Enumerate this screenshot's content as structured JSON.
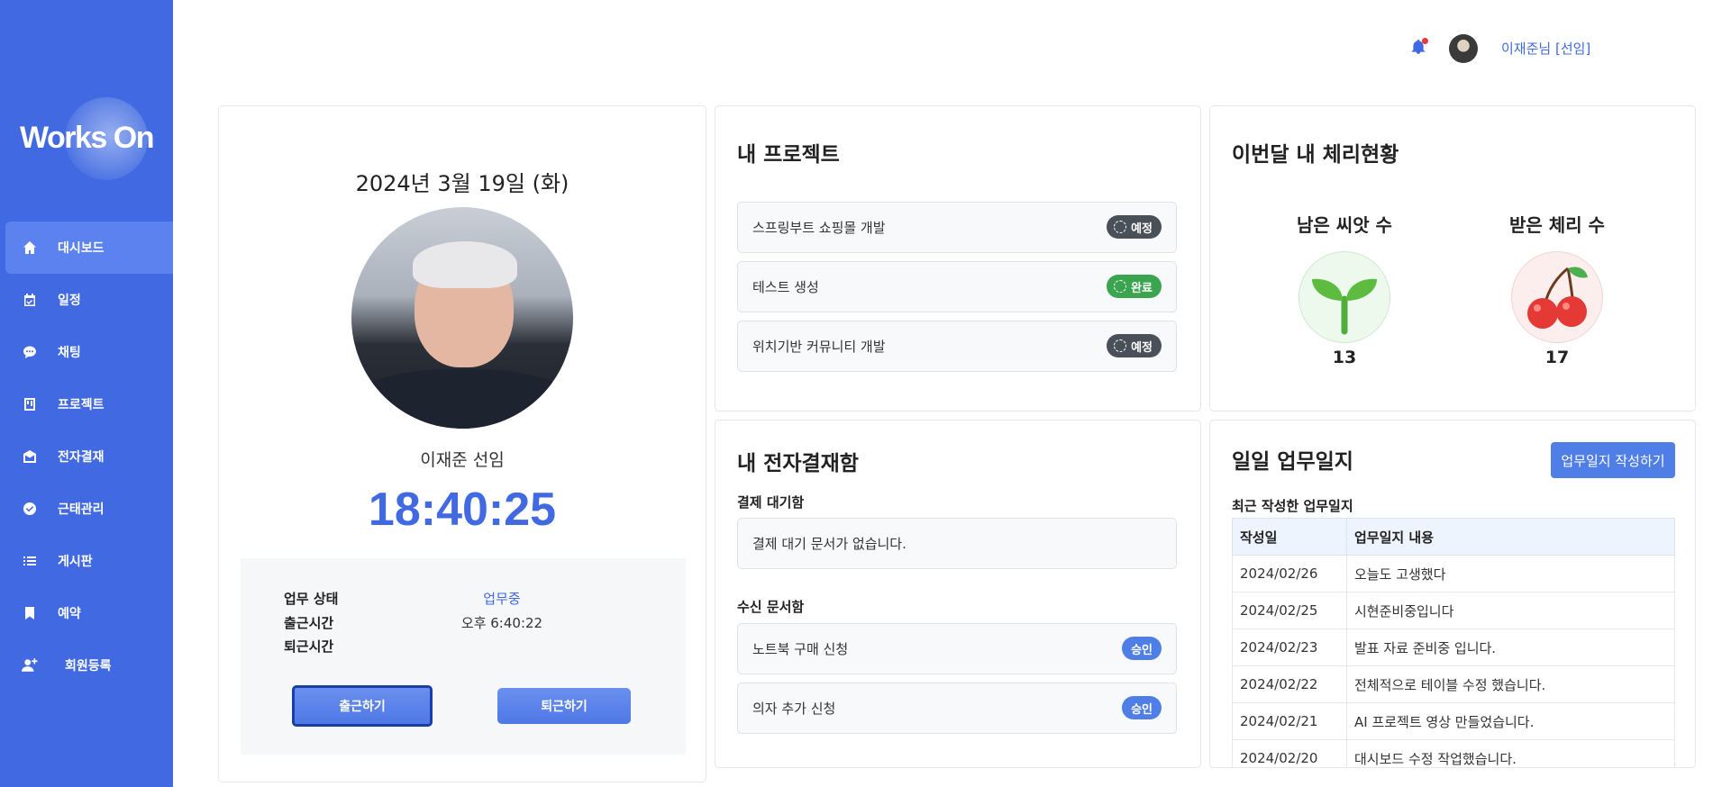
{
  "brand": {
    "logo_text": "Works On"
  },
  "sidebar": {
    "items": [
      {
        "label": "대시보드",
        "icon": "home-icon"
      },
      {
        "label": "일정",
        "icon": "calendar-icon"
      },
      {
        "label": "채팅",
        "icon": "chat-icon"
      },
      {
        "label": "프로젝트",
        "icon": "project-icon"
      },
      {
        "label": "전자결재",
        "icon": "mail-icon"
      },
      {
        "label": "근태관리",
        "icon": "check-badge-icon"
      },
      {
        "label": "게시판",
        "icon": "list-icon"
      },
      {
        "label": "예약",
        "icon": "bookmark-icon"
      },
      {
        "label": "회원등록",
        "icon": "user-add-icon"
      }
    ]
  },
  "header": {
    "user_name": "이재준님 [선임]"
  },
  "profile": {
    "date": "2024년 3월 19일 (화)",
    "name": "이재준 선임",
    "clock": "18:40:25",
    "work_status_label": "업무 상태",
    "work_status_value": "업무중",
    "checkin_label": "출근시간",
    "checkin_value": "오후 6:40:22",
    "checkout_label": "퇴근시간",
    "checkout_value": "",
    "checkin_button": "출근하기",
    "checkout_button": "퇴근하기"
  },
  "projects": {
    "title": "내 프로젝트",
    "items": [
      {
        "name": "스프링부트 쇼핑몰 개발",
        "status": "예정"
      },
      {
        "name": "테스트 생성",
        "status": "완료"
      },
      {
        "name": "위치기반 커뮤니티 개발",
        "status": "예정"
      }
    ]
  },
  "cherry": {
    "title": "이번달 내 체리현황",
    "seed_label": "남은 씨앗 수",
    "seed_count": "13",
    "cherry_label": "받은 체리 수",
    "cherry_count": "17"
  },
  "approval": {
    "title": "내 전자결재함",
    "waiting_label": "결제 대기함",
    "waiting_empty": "결제 대기 문서가 없습니다.",
    "inbox_label": "수신 문서함",
    "inbox": [
      {
        "name": "노트북 구매 신청",
        "status": "승인"
      },
      {
        "name": "의자 추가 신청",
        "status": "승인"
      }
    ]
  },
  "daily_log": {
    "title": "일일 업무일지",
    "write_button": "업무일지 작성하기",
    "recent_label": "최근 작성한 업무일지",
    "columns": [
      "작성일",
      "업무일지 내용"
    ],
    "rows": [
      [
        "2024/02/26",
        "오늘도 고생했다"
      ],
      [
        "2024/02/25",
        "시현준비중입니다"
      ],
      [
        "2024/02/23",
        "발표 자료 준비중 입니다."
      ],
      [
        "2024/02/22",
        "전체적으로 테이블 수정 했습니다."
      ],
      [
        "2024/02/21",
        "AI 프로젝트 영상 만들었습니다."
      ],
      [
        "2024/02/20",
        "대시보드 수정 작업했습니다."
      ]
    ]
  }
}
